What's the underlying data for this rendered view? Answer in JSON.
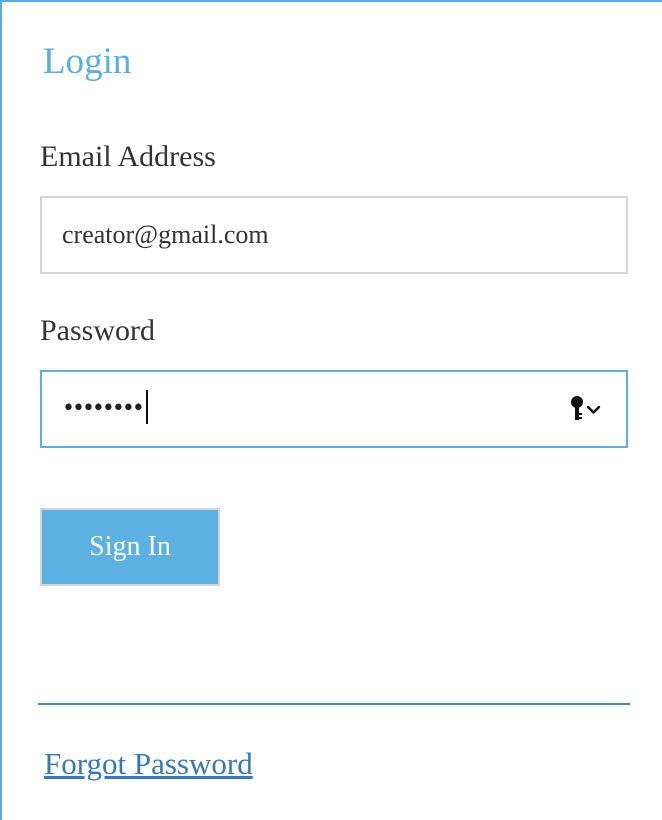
{
  "login": {
    "title": "Login",
    "email": {
      "label": "Email Address",
      "value": "creator@gmail.com"
    },
    "password": {
      "label": "Password",
      "masked_value": "••••••••",
      "autofill_icon": "key-dropdown-icon"
    },
    "signin_label": "Sign In",
    "forgot_label": "Forgot Password"
  },
  "colors": {
    "accent": "#5aaee0",
    "button_bg": "#5cb0e2",
    "link": "#3479b8",
    "divider": "#3d8ac4",
    "border": "#d6d6d6"
  }
}
